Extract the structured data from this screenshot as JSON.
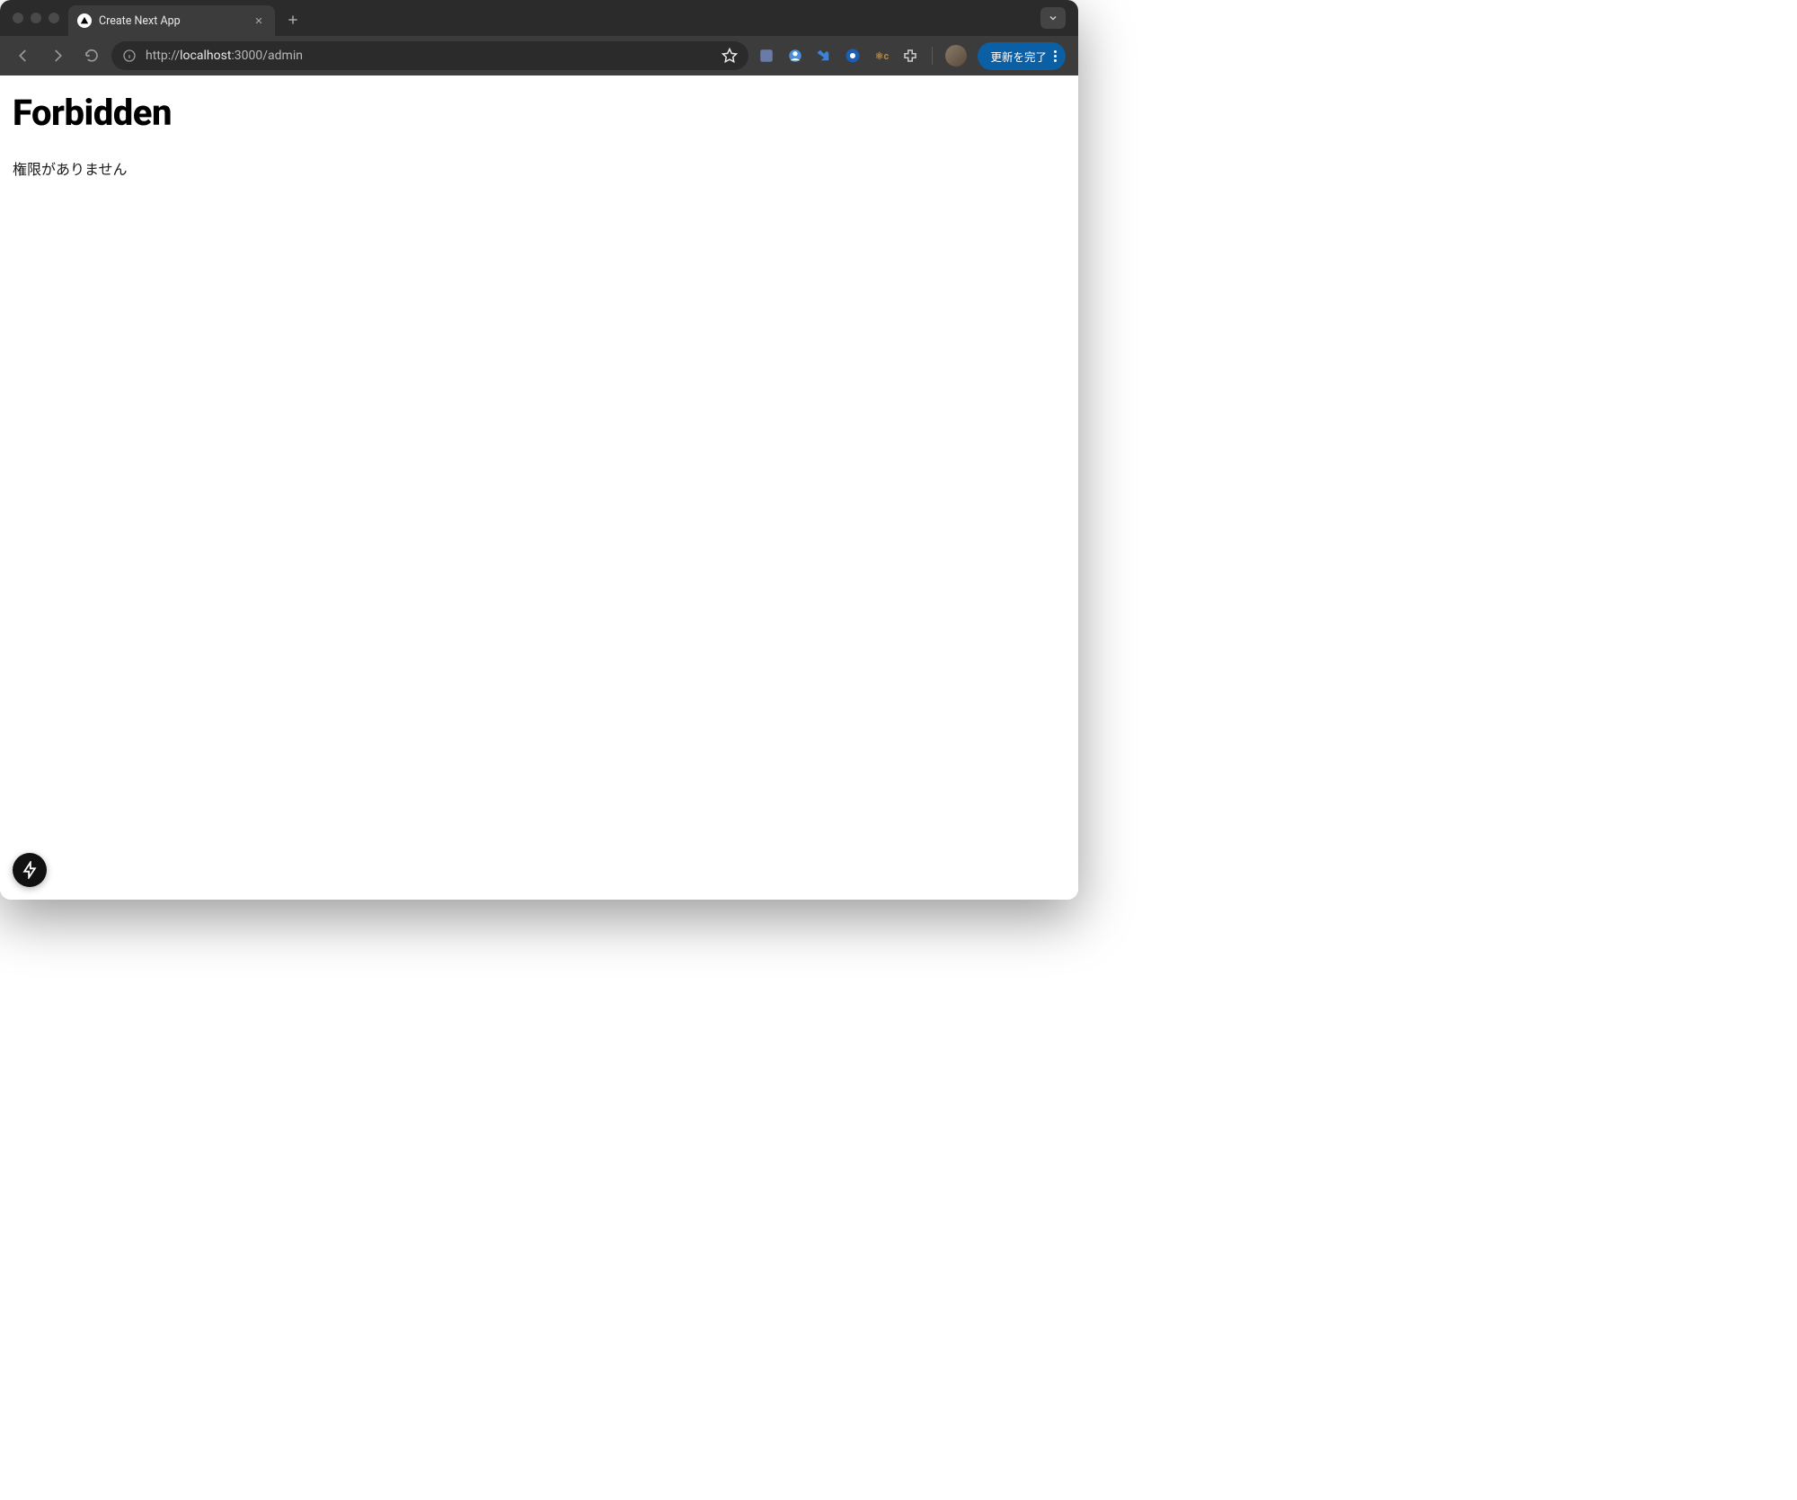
{
  "browser": {
    "tab": {
      "title": "Create Next App"
    },
    "url": {
      "scheme": "http://",
      "host": "localhost",
      "port_path": ":3000/admin"
    },
    "update_button_label": "更新を完了"
  },
  "page": {
    "heading": "Forbidden",
    "message": "権限がありません"
  }
}
